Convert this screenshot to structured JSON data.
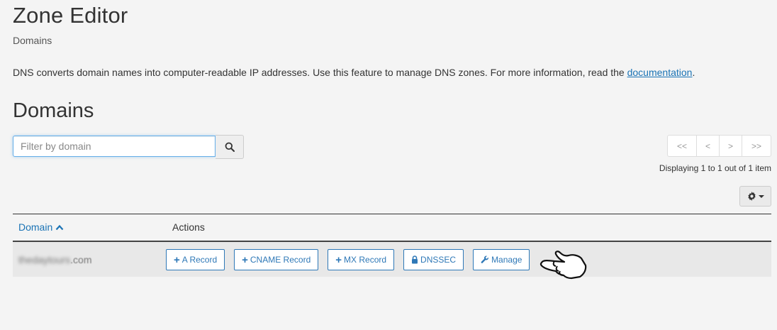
{
  "header": {
    "title": "Zone Editor",
    "breadcrumb": "Domains"
  },
  "description": {
    "text": "DNS converts domain names into computer-readable IP addresses. Use this feature to manage DNS zones. For more information, read the ",
    "link": "documentation",
    "suffix": "."
  },
  "section": {
    "title": "Domains"
  },
  "search": {
    "placeholder": "Filter by domain",
    "value": ""
  },
  "pager": {
    "first": "<<",
    "prev": "<",
    "next": ">",
    "last": ">>",
    "status": "Displaying 1 to 1 out of 1 item"
  },
  "table": {
    "columns": {
      "domain": "Domain",
      "actions": "Actions"
    },
    "rows": [
      {
        "domain_blurred": "thedaytours",
        "domain_suffix": ".com",
        "actions": {
          "a_record": "A Record",
          "cname_record": "CNAME Record",
          "mx_record": "MX Record",
          "dnssec": "DNSSEC",
          "manage": "Manage"
        }
      }
    ]
  },
  "colors": {
    "link": "#1a73b5",
    "button": "#2e78b7",
    "row_bg": "#e8e8e8"
  }
}
